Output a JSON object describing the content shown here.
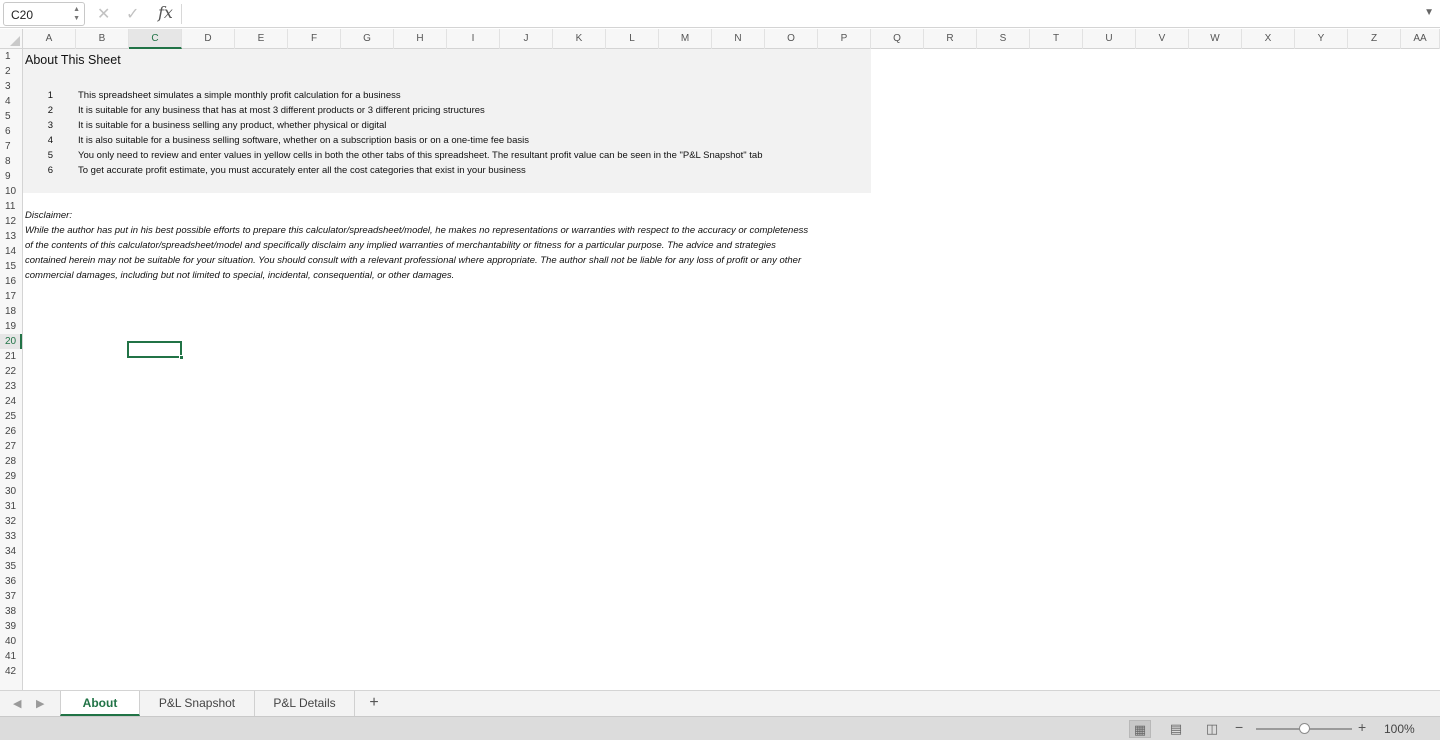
{
  "formula_bar": {
    "name_box": "C20",
    "stepper_up": "▲",
    "stepper_down": "▼",
    "cancel_glyph": "✕",
    "enter_glyph": "✓",
    "fx_label": "fx",
    "formula_value": "",
    "expand_glyph": "▼"
  },
  "grid": {
    "columns": [
      "A",
      "B",
      "C",
      "D",
      "E",
      "F",
      "G",
      "H",
      "I",
      "J",
      "K",
      "L",
      "M",
      "N",
      "O",
      "P",
      "Q",
      "R",
      "S",
      "T",
      "U",
      "V",
      "W",
      "X",
      "Y",
      "Z",
      "AA"
    ],
    "active_column": "C",
    "rows": [
      "1",
      "2",
      "3",
      "4",
      "5",
      "6",
      "7",
      "8",
      "9",
      "10",
      "11",
      "12",
      "13",
      "14",
      "15",
      "16",
      "17",
      "18",
      "19",
      "20",
      "21",
      "22",
      "23",
      "24",
      "25",
      "26",
      "27",
      "28",
      "29",
      "30",
      "31",
      "32",
      "33",
      "34",
      "35",
      "36",
      "37",
      "38",
      "39",
      "40",
      "41",
      "42"
    ],
    "active_row": "20",
    "selected_cell": "C20"
  },
  "about": {
    "heading": "About This Sheet",
    "items": [
      {
        "num": "1",
        "text": "This spreadsheet simulates a simple monthly profit calculation for a business"
      },
      {
        "num": "2",
        "text": "It is suitable for any business that has at most 3 different products or 3 different pricing structures"
      },
      {
        "num": "3",
        "text": "It is suitable for a business selling any product, whether physical or digital"
      },
      {
        "num": "4",
        "text": "It is also suitable for a business selling software, whether on a subscription basis or on a one-time fee basis"
      },
      {
        "num": "5",
        "text": "You only need to review and enter values in yellow cells in both the other tabs of this spreadsheet. The resultant profit value can be seen in the \"P&L Snapshot\" tab"
      },
      {
        "num": "6",
        "text": "To get accurate profit estimate, you must accurately enter all the cost categories that exist in your business"
      }
    ]
  },
  "disclaimer": {
    "title": "Disclaimer:",
    "lines": [
      "While the author has put in his best possible efforts to prepare this calculator/spreadsheet/model,  he makes no representations or warranties with respect to the accuracy or completeness",
      "of the contents of this calculator/spreadsheet/model and specifically disclaim any implied warranties of merchantability or fitness for a particular purpose. The advice and strategies",
      "contained herein may not be suitable for your situation. You should consult with a relevant professional where appropriate. The author shall not be liable for any loss of profit or any other",
      "commercial damages, including but not limited to special, incidental, consequential, or other damages."
    ]
  },
  "tabs": {
    "prev_glyph": "◀",
    "next_glyph": "▶",
    "sheets": [
      {
        "label": "About",
        "active": true
      },
      {
        "label": "P&L Snapshot",
        "active": false
      },
      {
        "label": "P&L Details",
        "active": false
      }
    ],
    "add_label": "+"
  },
  "status_bar": {
    "view_normal_glyph": "▦",
    "view_page_layout_glyph": "▤",
    "view_page_break_glyph": "◫",
    "zoom_out_glyph": "−",
    "zoom_in_glyph": "+",
    "zoom_level": "100%",
    "zoom_fraction": 0.5
  },
  "colors": {
    "accent": "#217346",
    "about_background": "#f2f2f2"
  }
}
